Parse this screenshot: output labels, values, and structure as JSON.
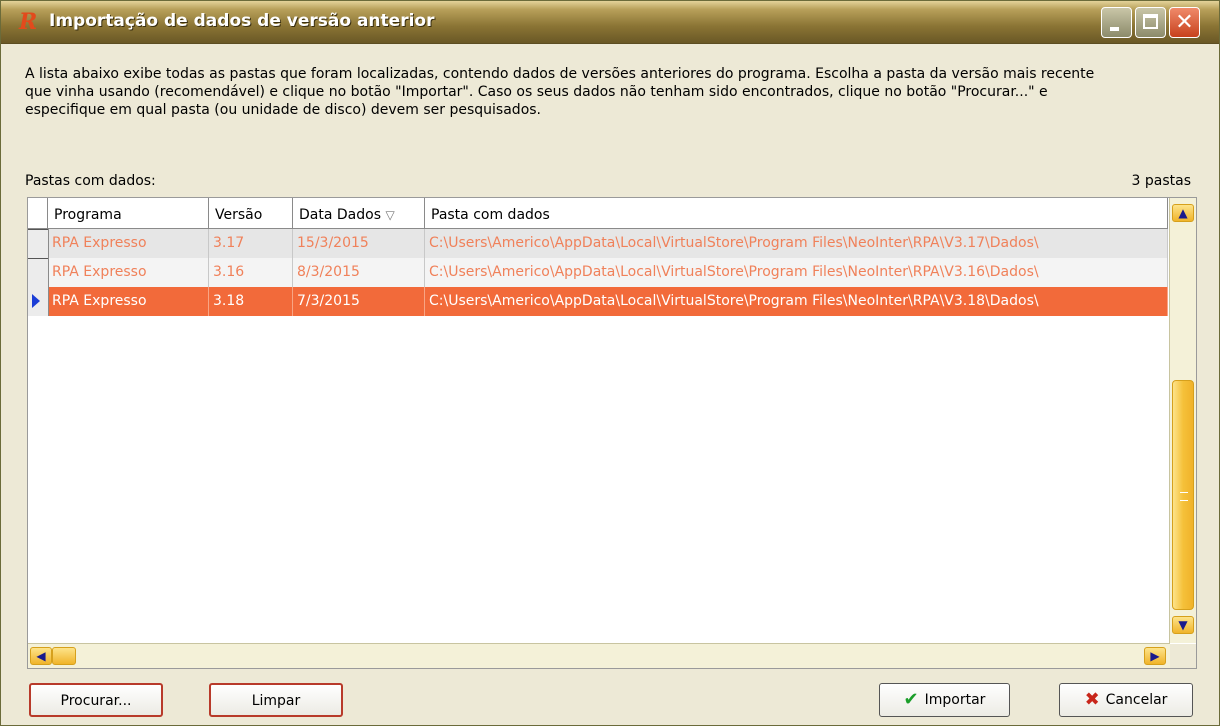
{
  "window": {
    "title": "Importação de dados de versão anterior",
    "logo": "R"
  },
  "description": [
    "A lista abaixo exibe todas as pastas que foram localizadas, contendo dados de versões anteriores do programa. Escolha a pasta da versão mais recente",
    "que vinha usando (recomendável) e clique no botão \"Importar\". Caso os seus dados não tenham sido encontrados, clique no botão \"Procurar...\" e",
    "especifique em qual pasta (ou unidade de disco) devem ser pesquisados."
  ],
  "list_label": "Pastas com dados:",
  "count_label": "3 pastas",
  "grid": {
    "columns": [
      "Programa",
      "Versão",
      "Data Dados",
      "Pasta com dados"
    ],
    "sort_indicator": "▽",
    "rows": [
      {
        "programa": "RPA Expresso",
        "versao": "3.17",
        "data": "15/3/2015",
        "pasta": "C:\\Users\\Americo\\AppData\\Local\\VirtualStore\\Program Files\\NeoInter\\RPA\\V3.17\\Dados\\"
      },
      {
        "programa": "RPA Expresso",
        "versao": "3.16",
        "data": "8/3/2015",
        "pasta": "C:\\Users\\Americo\\AppData\\Local\\VirtualStore\\Program Files\\NeoInter\\RPA\\V3.16\\Dados\\"
      },
      {
        "programa": "RPA Expresso",
        "versao": "3.18",
        "data": "7/3/2015",
        "pasta": "C:\\Users\\Americo\\AppData\\Local\\VirtualStore\\Program Files\\NeoInter\\RPA\\V3.18\\Dados\\"
      }
    ],
    "selected_row": 2
  },
  "buttons": {
    "procurar": "Procurar...",
    "limpar": "Limpar",
    "importar": "Importar",
    "cancelar": "Cancelar"
  },
  "colors": {
    "selected_row": "#f26a3a",
    "row_text": "#f0815a",
    "title_bar": "#8a7434",
    "scroll_thumb": "#f5c13a"
  },
  "icons": {
    "importar": "check-icon",
    "cancelar": "x-icon"
  }
}
